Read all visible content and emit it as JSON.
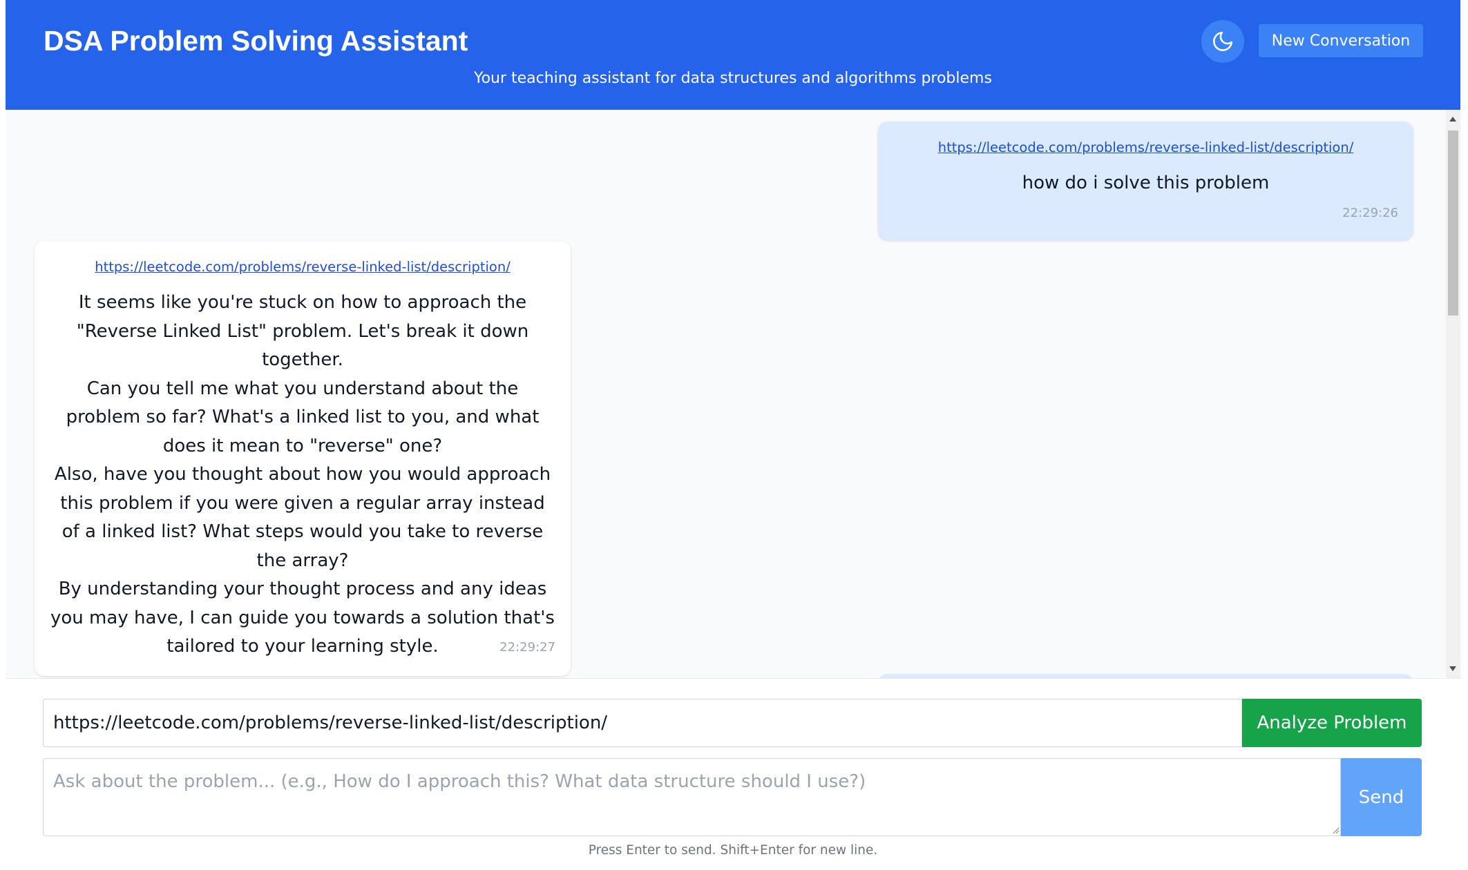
{
  "header": {
    "title": "DSA Problem Solving Assistant",
    "subtitle": "Your teaching assistant for data structures and algorithms problems",
    "theme_toggle_icon": "moon-icon",
    "new_conversation_label": "New Conversation"
  },
  "messages": [
    {
      "role": "user",
      "link": "https://leetcode.com/problems/reverse-linked-list/description/",
      "text": "how do i solve this problem",
      "time": "22:29:26"
    },
    {
      "role": "assistant",
      "link": "https://leetcode.com/problems/reverse-linked-list/description/",
      "paragraphs": [
        "It seems like you're stuck on how to approach the \"Reverse Linked List\" problem. Let's break it down together.",
        "Can you tell me what you understand about the problem so far? What's a linked list to you, and what does it mean to \"reverse\" one?",
        "Also, have you thought about how you would approach this problem if you were given a regular array instead of a linked list? What steps would you take to reverse the array?",
        "By understanding your thought process and any ideas you may have, I can guide you towards a solution that's tailored to your learning style."
      ],
      "time": "22:29:27"
    }
  ],
  "input": {
    "url_value": "https://leetcode.com/problems/reverse-linked-list/description/",
    "analyze_label": "Analyze Problem",
    "question_placeholder": "Ask about the problem... (e.g., How do I approach this? What data structure should I use?)",
    "send_label": "Send",
    "hint": "Press Enter to send. Shift+Enter for new line."
  },
  "colors": {
    "header_bg": "#2563eb",
    "button_blue": "#3b82f6",
    "user_bubble": "#dbeafe",
    "analyze_green": "#16a34a",
    "send_disabled": "#60a5fa",
    "link": "#1d4ed8"
  }
}
